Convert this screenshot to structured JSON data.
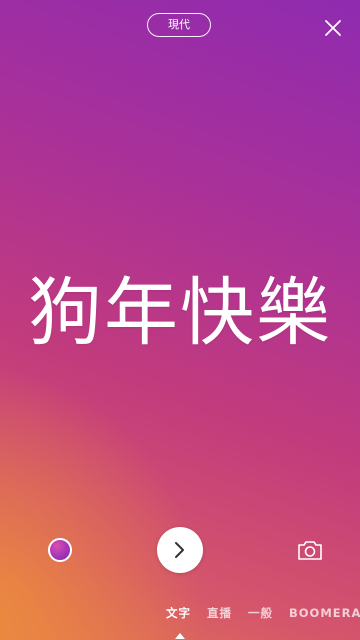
{
  "top_bar": {
    "font_style_label": "現代"
  },
  "canvas": {
    "text": "狗年快樂"
  },
  "bottom_controls": {
    "color_picker_icon": "color-swatch",
    "next_icon": "chevron-right",
    "camera_icon": "camera"
  },
  "modes": [
    {
      "label": "文字",
      "active": true
    },
    {
      "label": "直播",
      "active": false
    },
    {
      "label": "一般",
      "active": false
    },
    {
      "label": "BOOMERANG",
      "active": false
    }
  ],
  "colors": {
    "gradient_top_right": "#8f2bb0",
    "gradient_mid": "#c23b7d",
    "gradient_bottom_left": "#e27552",
    "foreground": "#ffffff"
  }
}
